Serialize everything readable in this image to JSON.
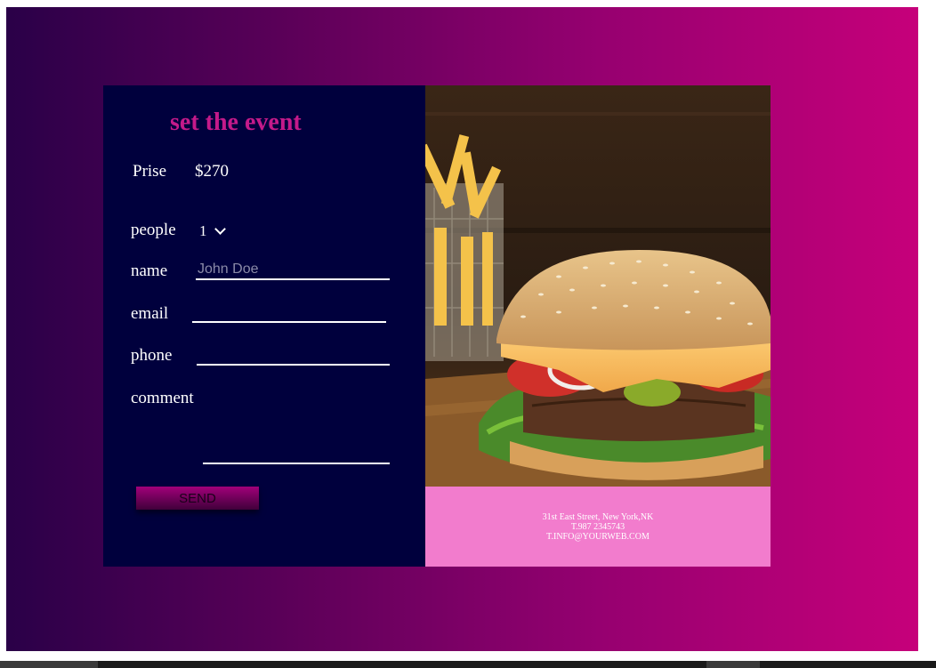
{
  "form": {
    "title": "set the event",
    "price_label": "Prise",
    "price_value": "$270",
    "people_label": "people",
    "people_selected": "1",
    "name_label": "name",
    "name_placeholder": "John Doe",
    "email_label": "email",
    "phone_label": "phone",
    "comment_label": "comment",
    "send_label": "SEND"
  },
  "info": {
    "address": "31st East Street, New York,NK",
    "phone": "T.987 2345743",
    "email": "T.INFO@YOURWEB.COM"
  },
  "colors": {
    "accent": "#c41a8a",
    "form_bg": "#00003d",
    "info_band": "#f27ccd"
  }
}
